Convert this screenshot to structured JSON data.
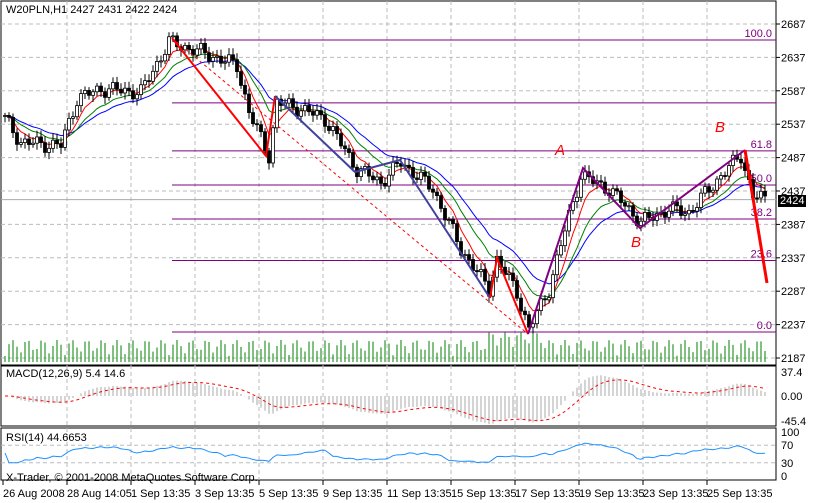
{
  "header": {
    "symbol_info": "W20PLN,H1  2427 2431 2422 2424"
  },
  "macd_label": "MACD(12,26,9) 5.4 14.6",
  "rsi_label": "RSI(14) 44.6653",
  "copyright": "X-Trader, © 2001-2008 MetaQuotes Software Corp.",
  "current_price": "2424",
  "colors": {
    "ma_fast": "#ff0000",
    "ma_mid": "#008000",
    "ma_slow": "#0000ff",
    "fib": "#800080",
    "wave": "#ff0000",
    "volume": "#008000",
    "rsi": "#1e90ff"
  },
  "chart_data": {
    "type": "candlestick",
    "title": "W20PLN,H1",
    "ylim": [
      2177,
      2712
    ],
    "y_ticks": [
      "2687",
      "2637",
      "2587",
      "2537",
      "2487",
      "2437",
      "2387",
      "2337",
      "2287",
      "2237",
      "2187"
    ],
    "x_ticks": [
      "26 Aug 2008",
      "28 Aug 14:05",
      "1 Sep 13:35",
      "3 Sep 13:35",
      "5 Sep 13:35",
      "9 Sep 13:35",
      "11 Sep 13:35",
      "15 Sep 13:35",
      "17 Sep 13:35",
      "19 Sep 13:35",
      "23 Sep 13:35",
      "25 Sep 13:35"
    ],
    "price_path": [
      [
        0,
        2545
      ],
      [
        4,
        2510
      ],
      [
        14,
        2505
      ],
      [
        18,
        2575
      ],
      [
        24,
        2590
      ],
      [
        34,
        2585
      ],
      [
        41,
        2660
      ],
      [
        49,
        2645
      ],
      [
        58,
        2625
      ],
      [
        61,
        2555
      ],
      [
        66,
        2490
      ],
      [
        68,
        2570
      ],
      [
        74,
        2560
      ],
      [
        80,
        2545
      ],
      [
        88,
        2470
      ],
      [
        94,
        2450
      ],
      [
        99,
        2480
      ],
      [
        107,
        2440
      ],
      [
        114,
        2350
      ],
      [
        121,
        2290
      ],
      [
        123,
        2335
      ],
      [
        128,
        2285
      ],
      [
        131,
        2230
      ],
      [
        136,
        2290
      ],
      [
        141,
        2400
      ],
      [
        144,
        2460
      ],
      [
        151,
        2440
      ],
      [
        156,
        2410
      ],
      [
        159,
        2390
      ],
      [
        166,
        2410
      ],
      [
        171,
        2405
      ],
      [
        179,
        2460
      ],
      [
        184,
        2490
      ],
      [
        187,
        2430
      ],
      [
        190,
        2424
      ]
    ],
    "fib_levels": [
      {
        "label": "100.0",
        "price": 2663
      },
      {
        "label": "61.8",
        "price": 2497
      },
      {
        "label": "50.0",
        "price": 2446
      },
      {
        "label": "38.2",
        "price": 2395
      },
      {
        "label": "23.6",
        "price": 2333
      },
      {
        "label": "0.0",
        "price": 2226
      }
    ],
    "extra_level": 2569,
    "annotations": [
      "A",
      "B",
      "B"
    ],
    "macd": {
      "ticks": [
        "37.4",
        "0.00",
        "-45.4"
      ]
    },
    "rsi": {
      "ticks": [
        "100",
        "70",
        "30",
        "0"
      ]
    }
  }
}
